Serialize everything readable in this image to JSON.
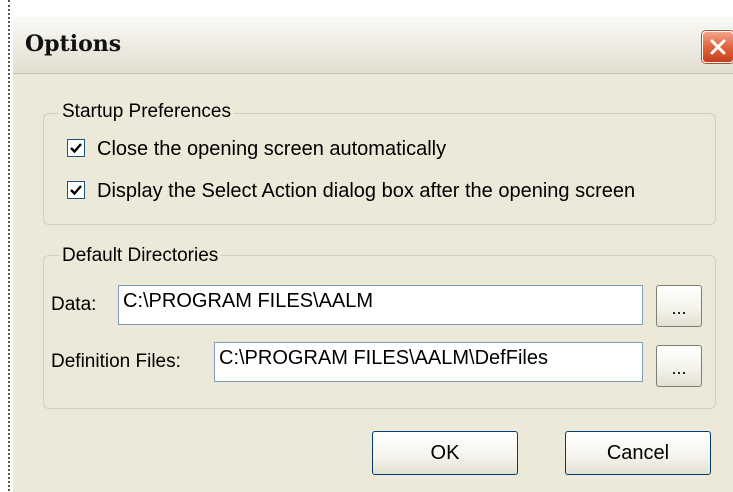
{
  "window": {
    "title": "Options"
  },
  "startup": {
    "legend": "Startup Preferences",
    "options": [
      {
        "label": "Close the opening screen automatically",
        "checked": true
      },
      {
        "label": "Display the Select Action dialog box after the opening screen",
        "checked": true
      }
    ]
  },
  "directories": {
    "legend": "Default Directories",
    "data_label": "Data:",
    "data_value": "C:\\PROGRAM FILES\\AALM",
    "definition_label": "Definition Files:",
    "definition_value": "C:\\PROGRAM FILES\\AALM\\DefFiles",
    "browse_label": "..."
  },
  "buttons": {
    "ok": "OK",
    "cancel": "Cancel"
  },
  "colors": {
    "dialog_bg": "#ece9d8",
    "close_button": "#e0643f",
    "checkmark": "#21a121"
  }
}
